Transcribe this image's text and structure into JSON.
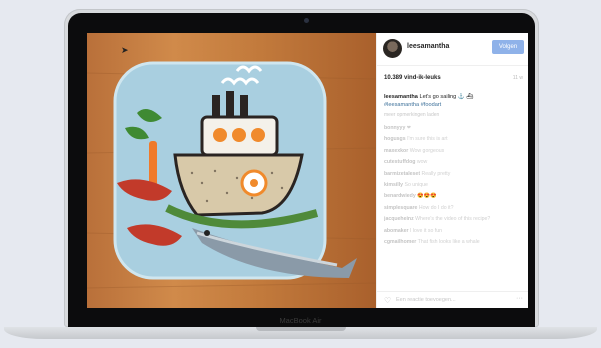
{
  "device": {
    "brand_label": "MacBook Air"
  },
  "post": {
    "username": "leesamantha",
    "follow_label": "Volgen",
    "likes": "10.389 vind-ik-leuks",
    "time": "11 w",
    "caption_user": "leesamantha",
    "caption_text": "Let's go sailing ⚓ ⛴",
    "caption_tags": "#leesamantha #foodart",
    "more_comments": "meer opmerkingen laden",
    "comments": [
      {
        "user": "bonnyyy",
        "text": "❤"
      },
      {
        "user": "hogusgs",
        "text": "I'm sure this is art"
      },
      {
        "user": "maxexkor",
        "text": "Wow gorgeous"
      },
      {
        "user": "cutestuffdog",
        "text": "wow"
      },
      {
        "user": "barmizetaleset",
        "text": "Really pretty"
      },
      {
        "user": "kimsilly",
        "text": "So unique"
      },
      {
        "user": "benardwiedy",
        "text": "😍😍😍"
      },
      {
        "user": "simplesquare",
        "text": "How do I do it?"
      },
      {
        "user": "jacqueheinz",
        "text": "Where's the video of this recipe?"
      },
      {
        "user": "abomaker",
        "text": "I love it so fun"
      },
      {
        "user": "cgmailhomer",
        "text": "That fish looks like a whale"
      }
    ],
    "add_comment_placeholder": "Een reactie toevoegen..."
  }
}
